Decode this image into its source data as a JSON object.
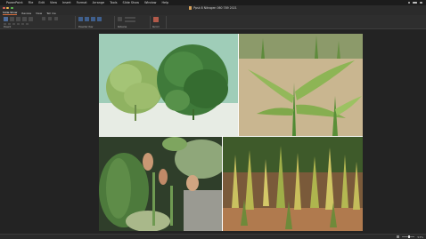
{
  "menubar": {
    "apple": "",
    "items": [
      "PowerPoint",
      "File",
      "Edit",
      "View",
      "Insert",
      "Format",
      "Arrange",
      "Tools",
      "Slide Show",
      "Window",
      "Help"
    ]
  },
  "window": {
    "title": "Ppsk 8 Nitrogen 060 789 2021"
  },
  "ribbon": {
    "tabs": [
      "Slide Show",
      "Review",
      "View",
      "Tell me"
    ],
    "active_tab": "Slide Show",
    "groups": [
      {
        "label": "Present"
      },
      {
        "label": "Presenter View"
      },
      {
        "label": "Rehearse"
      },
      {
        "label": "Record"
      },
      {
        "label": "Options"
      }
    ]
  },
  "slide": {
    "photos": [
      {
        "name": "tomato-plants-photo",
        "description_icon": "image-icon"
      },
      {
        "name": "corn-seedlings-photo",
        "description_icon": "image-icon"
      },
      {
        "name": "wilted-leaves-photo",
        "description_icon": "image-icon"
      },
      {
        "name": "yellow-corn-field-photo",
        "description_icon": "image-icon"
      }
    ]
  },
  "status": {
    "left": "",
    "zoom": "53%"
  },
  "colors": {
    "accent": "#d26b3a",
    "background": "#232323",
    "ribbon": "#2e2e2e"
  }
}
